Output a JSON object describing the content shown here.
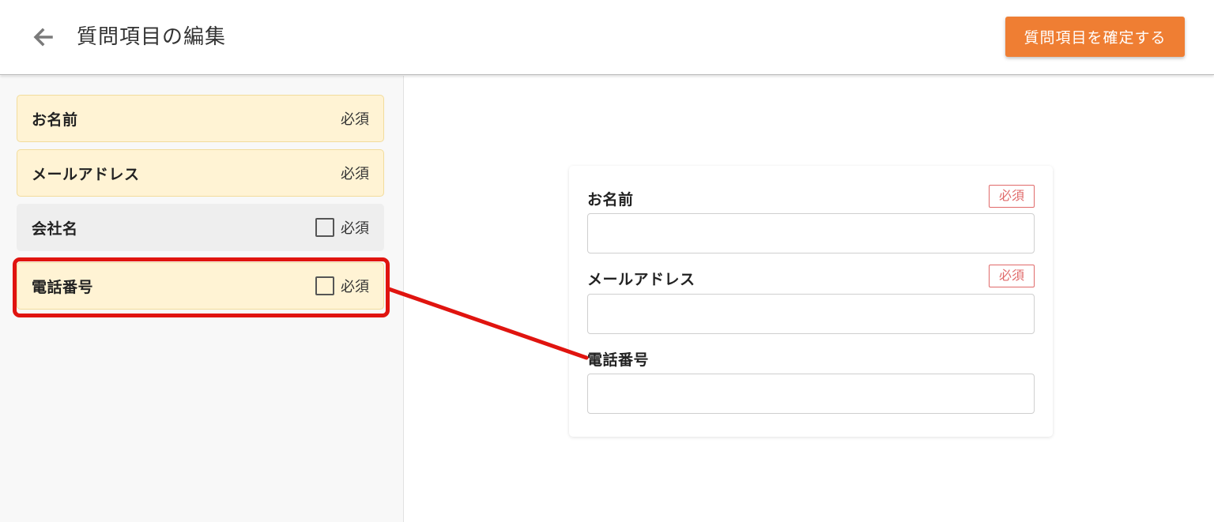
{
  "header": {
    "back_icon": "arrow-left-icon",
    "title": "質問項目の編集",
    "confirm_label": "質問項目を確定する"
  },
  "colors": {
    "accent": "#ef7e33",
    "item_highlight_bg": "#fff3d4",
    "annotation_red": "#e0140f",
    "required_badge": "#e06a6a"
  },
  "sidebar": {
    "items": [
      {
        "label": "お名前",
        "required_label": "必須",
        "state": "fixed-required"
      },
      {
        "label": "メールアドレス",
        "required_label": "必須",
        "state": "fixed-required"
      },
      {
        "label": "会社名",
        "required_label": "必須",
        "state": "disabled",
        "required_checked": false
      },
      {
        "label": "電話番号",
        "required_label": "必須",
        "state": "enabled",
        "required_checked": false
      }
    ]
  },
  "preview": {
    "fields": [
      {
        "label": "お名前",
        "badge": "必須",
        "value": ""
      },
      {
        "label": "メールアドレス",
        "badge": "必須",
        "value": ""
      },
      {
        "label": "電話番号",
        "value": ""
      }
    ]
  }
}
